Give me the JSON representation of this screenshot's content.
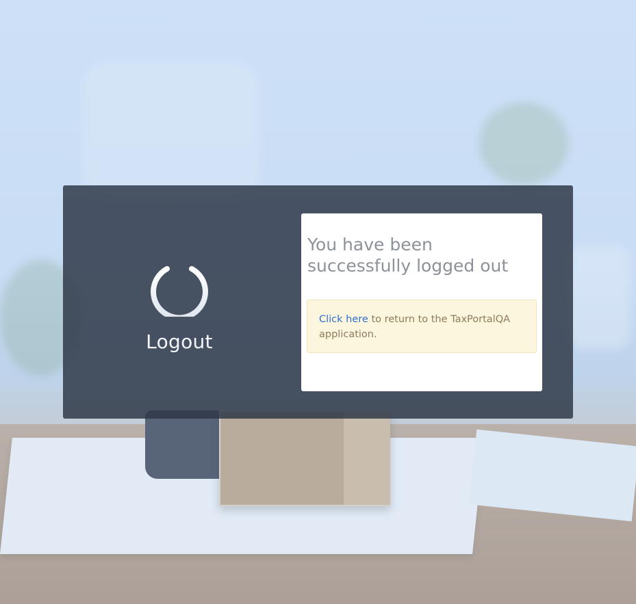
{
  "logout": {
    "icon": "power-icon",
    "label": "Logout"
  },
  "message": {
    "title": "You have been successfully logged out",
    "link_text": "Click here",
    "body_text": " to return to the TaxPortalQA application."
  },
  "colors": {
    "panel": "#2d3746",
    "card": "#ffffff",
    "alert_bg": "#fcf6de",
    "link": "#2f6fd0",
    "title": "#8b9299"
  }
}
